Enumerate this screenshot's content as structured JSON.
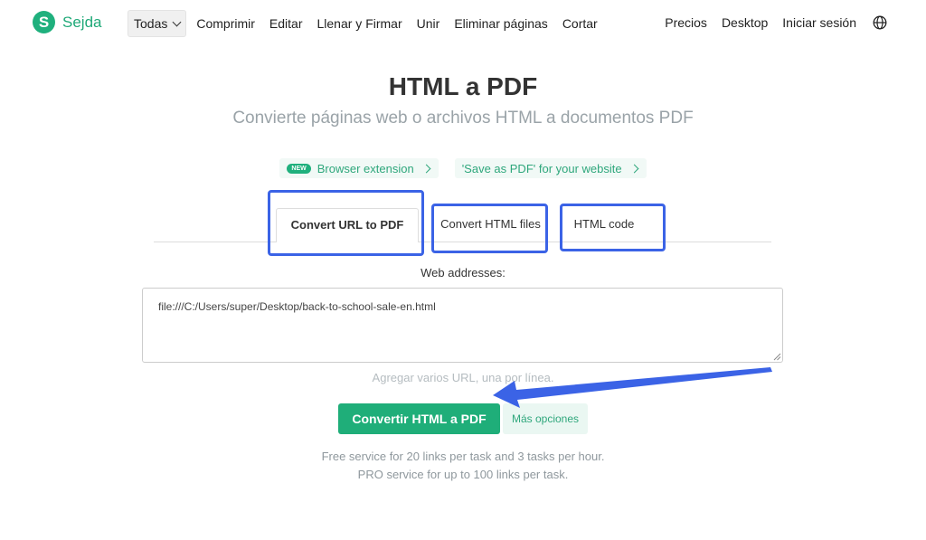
{
  "nav": {
    "logo_letter": "S",
    "logo_text": "Sejda",
    "items": [
      {
        "label": "Todas",
        "active": true
      },
      {
        "label": "Comprimir"
      },
      {
        "label": "Editar"
      },
      {
        "label": "Llenar y Firmar"
      },
      {
        "label": "Unir"
      },
      {
        "label": "Eliminar páginas"
      },
      {
        "label": "Cortar"
      }
    ],
    "right_items": [
      {
        "label": "Precios"
      },
      {
        "label": "Desktop"
      },
      {
        "label": "Iniciar sesión"
      }
    ],
    "globe_icon": "globe-icon"
  },
  "hero": {
    "title": "HTML a PDF",
    "subtitle": "Convierte páginas web o archivos HTML a documentos PDF"
  },
  "pills": {
    "new_badge": "NEW",
    "browser_extension": "Browser extension",
    "save_as_pdf": "'Save as PDF' for your website"
  },
  "tabs": [
    {
      "label": "Convert URL to PDF",
      "active": true
    },
    {
      "label": "Convert HTML files"
    },
    {
      "label": "HTML code"
    }
  ],
  "form": {
    "label": "Web addresses:",
    "url_value": "file:///C:/Users/super/Desktop/back-to-school-sale-en.html",
    "hint": "Agregar varios URL, una por línea."
  },
  "actions": {
    "convert": "Convertir HTML a PDF",
    "more_options": "Más opciones"
  },
  "info": {
    "line1": "Free service for 20 links per task and 3 tasks per hour.",
    "line2": "PRO service for up to 100 links per task."
  },
  "colors": {
    "brand": "#1fae79",
    "highlight": "#3b63e6"
  }
}
